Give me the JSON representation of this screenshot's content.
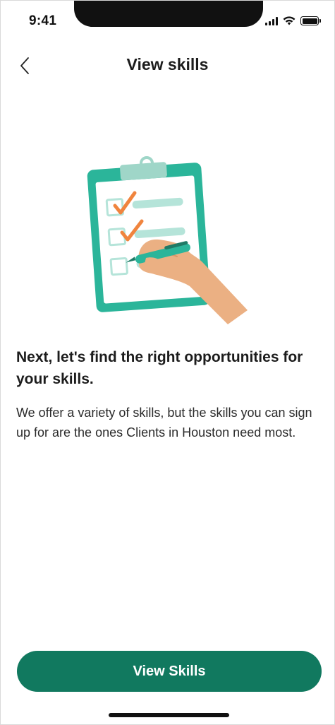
{
  "status_bar": {
    "time": "9:41",
    "icons": [
      "signal-icon",
      "wifi-icon",
      "battery-icon"
    ]
  },
  "header": {
    "back_icon": "chevron-left-icon",
    "title": "View skills"
  },
  "illustration": {
    "name": "clipboard-checklist-illustration",
    "colors": {
      "clipboard": "#2bb59a",
      "paper": "#ffffff",
      "line": "#b5e4d9",
      "check": "#f0843e",
      "hand": "#ebb083",
      "pen": "#2bb59a"
    }
  },
  "main": {
    "headline": "Next, let's find the right opportunities for your skills.",
    "body": "We offer a variety of skills, but the skills you can sign up for are the ones Clients in Houston need most."
  },
  "footer": {
    "primary_button_label": "View Skills"
  },
  "theme": {
    "accent": "#11795f",
    "text": "#1c1c1c",
    "background": "#ffffff"
  }
}
